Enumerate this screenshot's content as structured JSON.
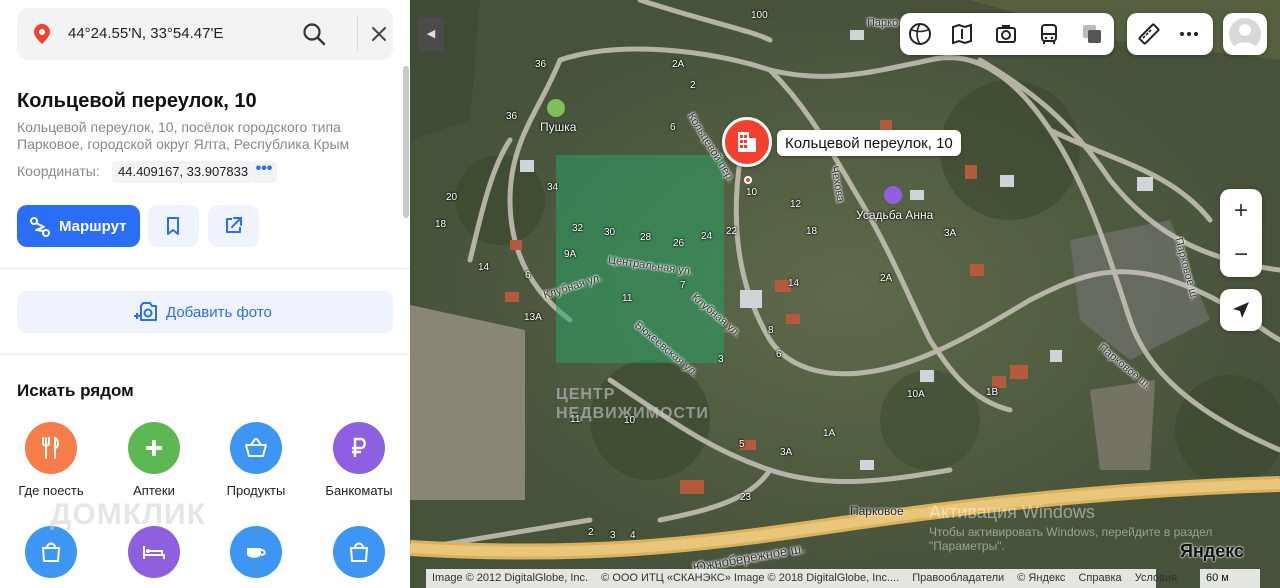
{
  "search": {
    "query": "44°24.55'N, 33°54.47'E"
  },
  "place": {
    "title": "Кольцевой переулок, 10",
    "address": "Кольцевой переулок, 10, посёлок городского типа Парковое, городской округ Ялта, Республика Крым",
    "coords_label": "Координаты:",
    "coords_value": "44.409167, 33.907833",
    "more": "•••"
  },
  "actions": {
    "route_label": "Маршрут"
  },
  "photo": {
    "add_label": "Добавить фото"
  },
  "nearby": {
    "title": "Искать рядом",
    "categories": [
      {
        "label": "Где поесть",
        "color": "#f47d4a",
        "icon": "fork-knife-icon"
      },
      {
        "label": "Аптеки",
        "color": "#5bb852",
        "icon": "plus-icon"
      },
      {
        "label": "Продукты",
        "color": "#3d96f3",
        "icon": "basket-icon"
      },
      {
        "label": "Банкоматы",
        "color": "#8e5fe0",
        "icon": "ruble-icon"
      }
    ],
    "row2": [
      {
        "color": "#3d96f3",
        "icon": "bag-icon"
      },
      {
        "color": "#8e5fe0",
        "icon": "bed-icon"
      },
      {
        "color": "#3d96f3",
        "icon": "cup-icon"
      },
      {
        "color": "#3d96f3",
        "icon": "bag-icon"
      }
    ]
  },
  "watermarks": {
    "domclick": "ДОМКЛИК",
    "center": "ЦЕНТР НЕДВИЖИМОСТИ",
    "win_title": "Активация Windows",
    "win_sub": "Чтобы активировать Windows, перейдите в раздел \"Параметры\"."
  },
  "map": {
    "marker_label": "Кольцевой переулок, 10",
    "pois": {
      "pushka": "Пушка",
      "usadba": "Усадьба Анна",
      "parkovoe": "Парковое"
    },
    "streets": {
      "koltsevoy": "Кольцевой пер.",
      "chekhova": "Чехова",
      "tsentralnaya": "Центральная ул.",
      "klubnaya": "Клубная ул.",
      "klubnaya2": "Клубная ул.",
      "bulkeevskaya": "Бюкеевская ул.",
      "parkovoe1": "Парковое ш.",
      "parkovoe2": "Парковое ш.",
      "parkovoe_top": "Парко",
      "yuzhnoberezhnoe": "Южнобережное ш."
    },
    "house_numbers": {
      "h100": "100",
      "h36a": "36",
      "h36b": "36",
      "h2a": "2А",
      "h2": "2",
      "h6": "6",
      "h10": "10",
      "h34": "34",
      "h20": "20",
      "h18": "18",
      "h14": "14",
      "h6b": "6",
      "h13a": "13А",
      "h9a": "9А",
      "h32": "32",
      "h30": "30",
      "h28": "28",
      "h26": "26",
      "h24": "24",
      "h22": "22",
      "h12": "12",
      "h18b": "18",
      "h3a": "3А",
      "h2a2": "2А",
      "h14b": "14",
      "h8": "8",
      "h6c": "6",
      "h3": "3",
      "h11": "11",
      "h10b": "10",
      "h1a": "1А",
      "h3a2": "3А",
      "h5": "5",
      "h23": "23",
      "h10a": "10А",
      "h1v": "1В",
      "h2b": "2",
      "h3b": "3",
      "h4": "4",
      "h7": "7",
      "h11b": "11"
    },
    "attribution": [
      "Image © 2012 DigitalGlobe, Inc.",
      "© ООО ИТЦ «СКАНЭКС» Image © 2018 DigitalGlobe, Inc....",
      "Правообладатели",
      "© Яндекс",
      "Справка",
      "Условия"
    ],
    "scale": "60 м",
    "logo": "Яндекс",
    "zoom_in": "+",
    "zoom_out": "−"
  },
  "colors": {
    "accent": "#2b6ef5",
    "marker": "#f4412d"
  }
}
